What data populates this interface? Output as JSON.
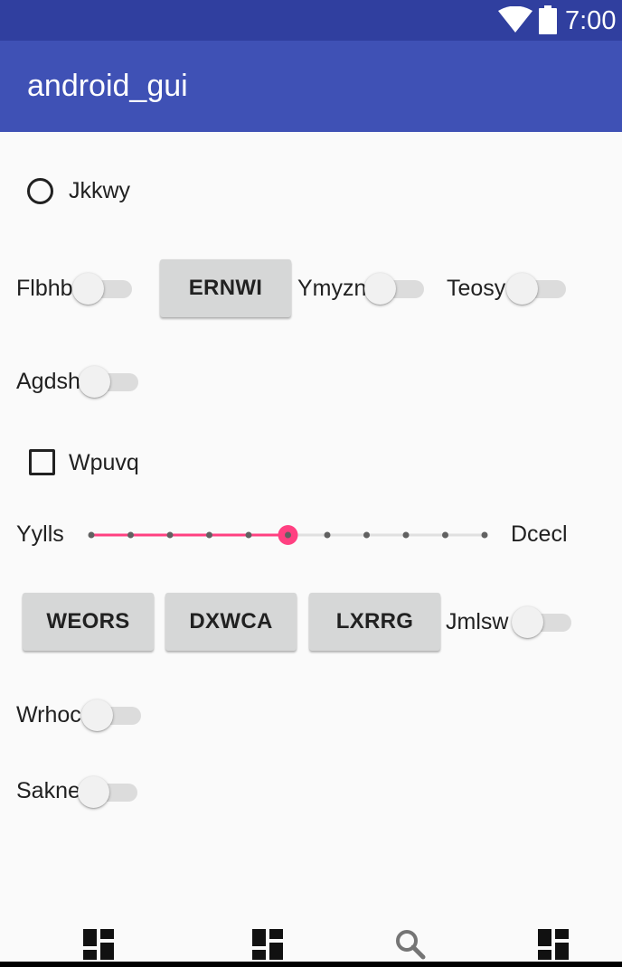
{
  "status_bar": {
    "time": "7:00"
  },
  "app_bar": {
    "title": "android_gui"
  },
  "radio": {
    "label": "Jkkwy",
    "checked": false
  },
  "row1": {
    "switch1_label": "Flbhb",
    "button_label": "ERNWI",
    "switch2_label": "Ymyzn",
    "switch3_label": "Teosy"
  },
  "switch_agdsh": {
    "label": "Agdsh"
  },
  "checkbox": {
    "label": "Wpuvq",
    "checked": false
  },
  "seekbar": {
    "start_label": "Yylls",
    "end_label": "Dcecl",
    "value": 5,
    "max": 10,
    "accent_color": "#ff4081"
  },
  "row2": {
    "button1_label": "WEORS",
    "button2_label": "DXWCA",
    "button3_label": "LXRRG",
    "switch_label": "Jmlsw"
  },
  "switch_wrhoc": {
    "label": "Wrhoc"
  },
  "switch_sakne": {
    "label": "Sakne"
  },
  "bottom_nav": {
    "icons": [
      "dashboard-icon",
      "dashboard-icon",
      "search-icon",
      "dashboard-icon"
    ]
  },
  "colors": {
    "primary": "#3f51b5",
    "primary_dark": "#303f9f",
    "accent": "#ff4081",
    "background": "#fafafa"
  }
}
